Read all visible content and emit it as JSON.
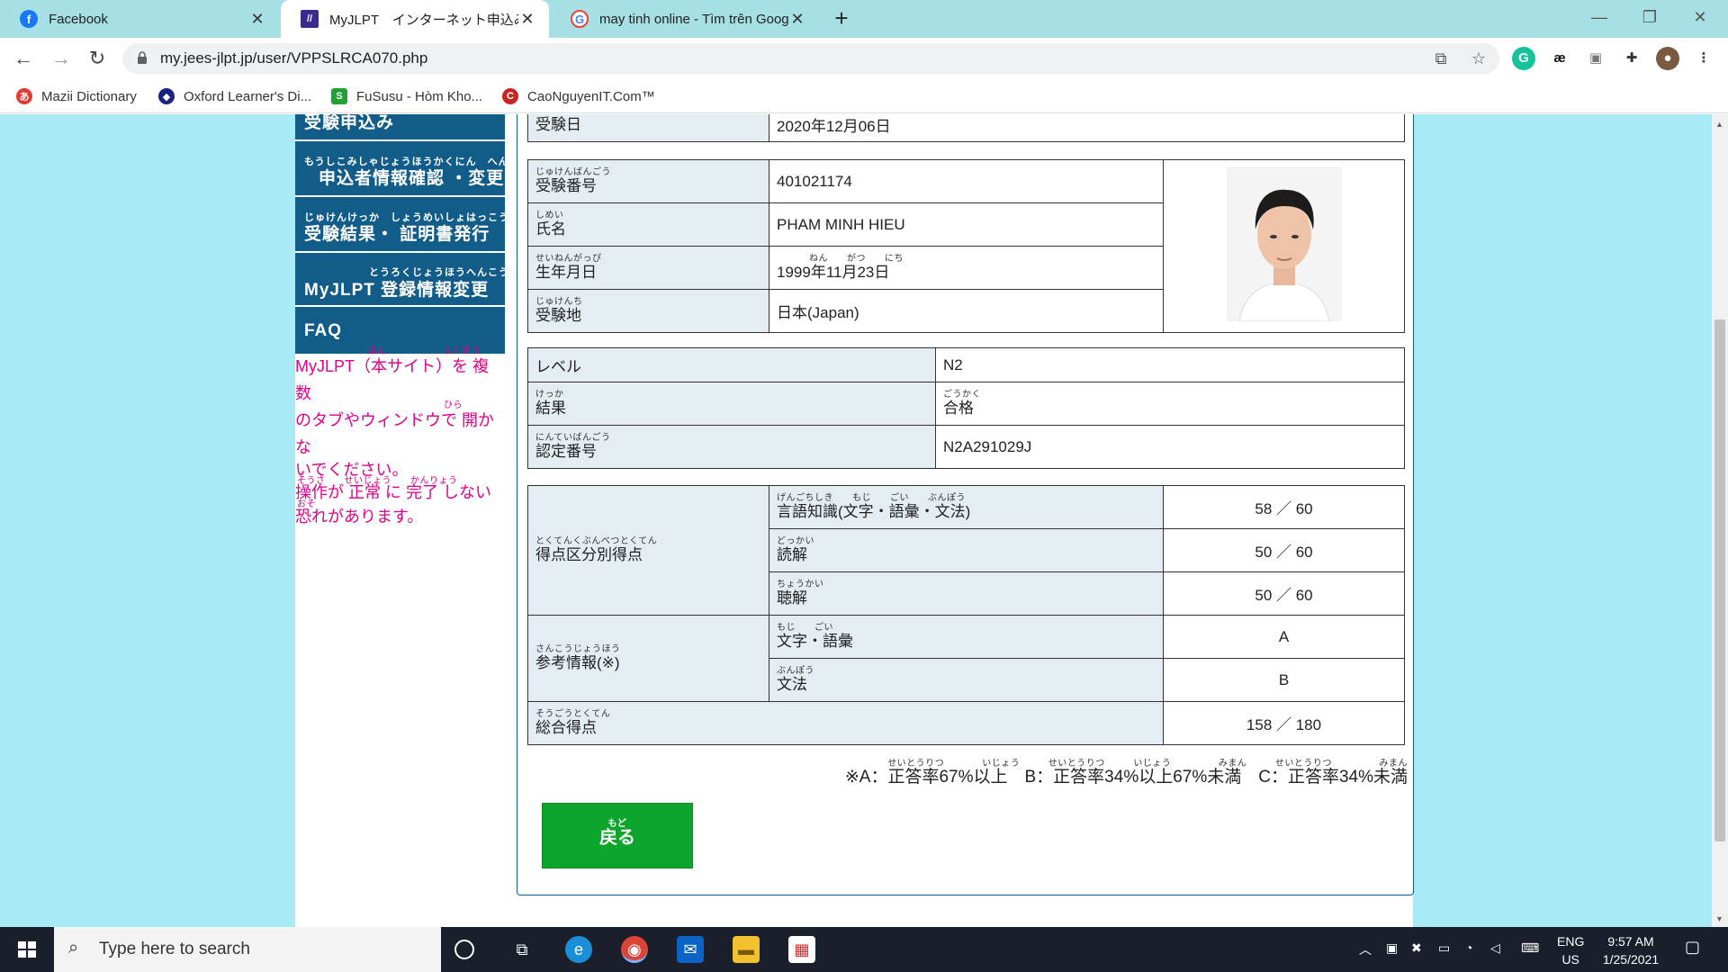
{
  "browser": {
    "tabs": [
      {
        "title": "Facebook",
        "icon": "facebook-icon",
        "color": "#1877f2"
      },
      {
        "title": "MyJLPT　インターネット申込み",
        "icon": "myjlpt-icon",
        "color": "#3a2a8c"
      },
      {
        "title": "may tinh online - Tìm trên Googl",
        "icon": "google-icon",
        "color": "#4285f4"
      }
    ],
    "url": "my.jees-jlpt.jp/user/VPPSLRCA070.php",
    "bookmarks": [
      {
        "label": "Mazii Dictionary",
        "color": "#e53935"
      },
      {
        "label": "Oxford Learner's Di...",
        "color": "#1a237e"
      },
      {
        "label": "FuSusu - Hòm Kho...",
        "color": "#21a035"
      },
      {
        "label": "CaoNguyenIT.Com™",
        "color": "#c62828"
      }
    ]
  },
  "sidebar": {
    "items": [
      {
        "ruby": "",
        "label": "受験申込み"
      },
      {
        "ruby": "もうしこみしゃじょうほうかくにん　へんこう",
        "label": "申込者情報確認 ・変更"
      },
      {
        "ruby": "じゅけんけっか　しょうめいしょはっこう",
        "label": "受験結果・ 証明書発行"
      },
      {
        "ruby": "とうろくじょうほうへんこう",
        "label": "MyJLPT 登録情報変更"
      },
      {
        "ruby": "",
        "label": "FAQ"
      }
    ],
    "notice": {
      "line1": "MyJLPT（本サイト）を 複数",
      "line2": "のタブやウィンドウで 開かな",
      "line3": "いでください。",
      "line4": "操作が 正常 に 完了 しない",
      "line5": "恐れがあります。",
      "ruby1": "ほん　　　　　　ふくすう",
      "ruby2": "ひら",
      "ruby4": "そうさ　　せいじょう　　かんりょう",
      "ruby5": "おそ"
    }
  },
  "exam": {
    "date_label": "受験日",
    "date_value": "2020年12月06日",
    "number": {
      "ruby": "じゅけんばんごう",
      "label": "受験番号",
      "value": "401021174"
    },
    "name": {
      "ruby": "しめい",
      "label": "氏名",
      "value": "PHAM MINH HIEU"
    },
    "birth": {
      "ruby": "せいねんがっぴ",
      "label": "生年月日",
      "value": "1999年11月23日",
      "value_ruby": "ねん　　がつ　　にち"
    },
    "site": {
      "ruby": "じゅけんち",
      "label": "受験地",
      "value": "日本(Japan)"
    }
  },
  "result": {
    "level": {
      "label": "レベル",
      "value": "N2"
    },
    "outcome": {
      "ruby": "けっか",
      "label": "結果",
      "value": "合格",
      "value_ruby": "ごうかく"
    },
    "cert": {
      "ruby": "にんていばんごう",
      "label": "認定番号",
      "value": "N2A291029J"
    }
  },
  "scores": {
    "section_ruby": "とくてんくぶんべつとくてん",
    "section_label": "得点区分別得点",
    "rows": [
      {
        "ruby": "げんごちしき　　もじ　　ごい　　ぶんぽう",
        "label": "言語知識(文字・語彙・文法)",
        "value": "58 ／ 60"
      },
      {
        "ruby": "どっかい",
        "label": "読解",
        "value": "50 ／ 60"
      },
      {
        "ruby": "ちょうかい",
        "label": "聴解",
        "value": "50 ／ 60"
      }
    ],
    "ref_ruby": "さんこうじょうほう",
    "ref_label": "参考情報(※)",
    "ref_rows": [
      {
        "ruby": "もじ　　ごい",
        "label": "文字・語彙",
        "value": "A"
      },
      {
        "ruby": "ぶんぽう",
        "label": "文法",
        "value": "B"
      }
    ],
    "total": {
      "ruby": "そうごうとくてん",
      "label": "総合得点",
      "value": "158 ／ 180"
    },
    "legend": "※A：正答率67%以上　B：正答率34%以上67%未満　C：正答率34%未満",
    "legend_ruby": "せいとうりつ　　　　いじょう　　　せいとうりつ　　　いじょう　　　　　みまん　　　せいとうりつ　　　　　みまん"
  },
  "back_button": {
    "ruby": "もど",
    "label": "戻る"
  },
  "taskbar": {
    "search_placeholder": "Type here to search",
    "lang": "ENG",
    "region": "US",
    "time": "9:57 AM",
    "date": "1/25/2021"
  }
}
